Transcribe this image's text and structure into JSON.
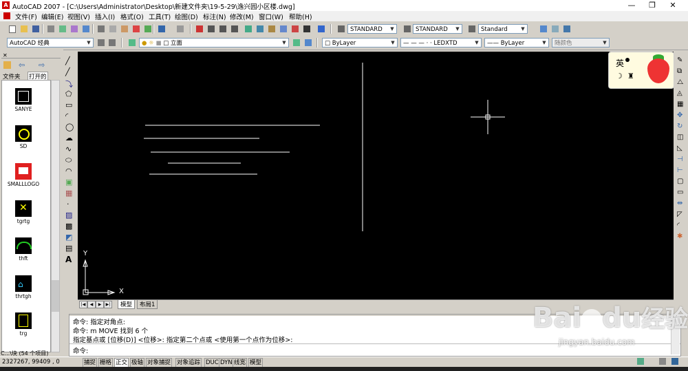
{
  "window": {
    "title": "AutoCAD 2007 - [C:\\Users\\Administrator\\Desktop\\新建文件夹\\19-5-29\\逸兴园小区楼.dwg]",
    "logo_text": "A",
    "min_glyph": "—",
    "restore_glyph": "❐",
    "close_glyph": "✕"
  },
  "menu": [
    "文件(F)",
    "编辑(E)",
    "视图(V)",
    "插入(I)",
    "格式(O)",
    "工具(T)",
    "绘图(D)",
    "标注(N)",
    "修改(M)",
    "窗口(W)",
    "帮助(H)"
  ],
  "toolbar1": {
    "text_style": "STANDARD",
    "dim_style": "STANDARD",
    "table_style": "Standard"
  },
  "toolbar2": {
    "workspace": "AutoCAD 经典",
    "layer": "立面",
    "color": "ByLayer",
    "linetype": "LEDXTD",
    "lineweight": "ByLayer",
    "plotstyle": "随颜色"
  },
  "palette": {
    "tabs": [
      "文件夹",
      "打开的"
    ],
    "items": [
      {
        "label": "SANYE",
        "icon": "sanye-block-icon"
      },
      {
        "label": "SD",
        "icon": "sd-block-icon"
      },
      {
        "label": "SMALLLOGO",
        "icon": "smalllogo-block-icon"
      },
      {
        "label": "tgrtg",
        "icon": "tgrtg-block-icon"
      },
      {
        "label": "thft",
        "icon": "thft-block-icon"
      },
      {
        "label": "thrtgh",
        "icon": "thrtgh-block-icon"
      },
      {
        "label": "trg",
        "icon": "trg-block-icon"
      }
    ],
    "footer": "C...\\块 (54 个项目)"
  },
  "canvas": {
    "ucs_x": "X",
    "ucs_y": "Y"
  },
  "layout_tabs": [
    "模型",
    "布局1"
  ],
  "ime": {
    "label": "英"
  },
  "command": {
    "lines": [
      "命令: 指定对角点:",
      "命令: m MOVE 找到 6 个",
      "指定基点或 [位移(D)] <位移>:  指定第二个点或 <使用第一个点作为位移>:",
      "命令:"
    ]
  },
  "status": {
    "coords": "2327267, 99409 , 0",
    "buttons": [
      "捕捉",
      "栅格",
      "正交",
      "极轴",
      "对象捕捉",
      "对象追踪",
      "DUCS",
      "DYN",
      "线宽",
      "模型"
    ]
  },
  "watermark": {
    "brand": "Bai",
    "brand2": "du",
    "cn": "经验",
    "url": "jingyan.baidu.com"
  },
  "colors": {
    "canvas_bg": "#000000",
    "line": "#ffffff",
    "ui_bg": "#d4d0c8"
  }
}
